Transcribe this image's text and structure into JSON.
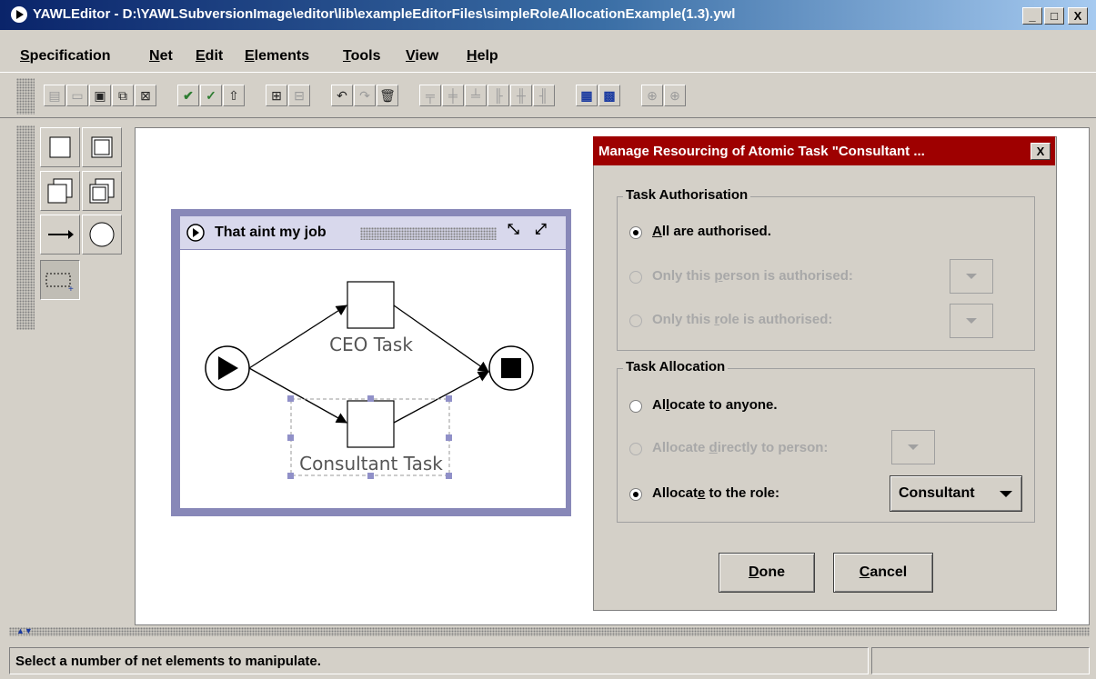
{
  "window": {
    "title": "YAWLEditor - D:\\YAWLSubversionImage\\editor\\lib\\exampleEditorFiles\\simpleRoleAllocationExample(1.3).ywl",
    "min_label": "_",
    "max_label": "□",
    "close_label": "X"
  },
  "menu": {
    "specification": {
      "mnemonic": "S",
      "rest": "pecification"
    },
    "net": {
      "mnemonic": "N",
      "rest": "et"
    },
    "edit": {
      "mnemonic": "E",
      "rest": "dit"
    },
    "elements": {
      "mnemonic": "E",
      "rest": "lements"
    },
    "tools": {
      "mnemonic": "T",
      "rest": "ools"
    },
    "view": {
      "mnemonic": "V",
      "rest": "iew"
    },
    "help": {
      "mnemonic": "H",
      "rest": "elp"
    }
  },
  "net": {
    "title": "That aint my job",
    "tasks": {
      "ceo": "CEO Task",
      "consultant": "Consultant Task"
    }
  },
  "dialog": {
    "title": "Manage Resourcing of Atomic Task \"Consultant ...",
    "close_label": "X",
    "authorisation": {
      "legend": "Task Authorisation",
      "all": {
        "pre": "",
        "mn": "A",
        "post": "ll are authorised."
      },
      "person": {
        "pre": "Only this ",
        "mn": "p",
        "post": "erson is authorised:"
      },
      "role": {
        "pre": "Only this ",
        "mn": "r",
        "post": "ole is authorised:"
      }
    },
    "allocation": {
      "legend": "Task Allocation",
      "anyone": {
        "pre": "Al",
        "mn": "l",
        "post": "ocate to anyone."
      },
      "direct": {
        "pre": "Allocate ",
        "mn": "d",
        "post": "irectly to person:"
      },
      "role": {
        "pre": "Allocat",
        "mn": "e",
        "post": " to the role:"
      },
      "role_value": "Consultant"
    },
    "done": {
      "mn": "D",
      "rest": "one"
    },
    "cancel": {
      "mn": "C",
      "rest": "ancel"
    }
  },
  "status": {
    "message": "Select a number of net elements to manipulate."
  },
  "colors": {
    "title_bar": "#0a246a",
    "dialog_title": "#9e0000",
    "net_frame": "#8888b8"
  }
}
